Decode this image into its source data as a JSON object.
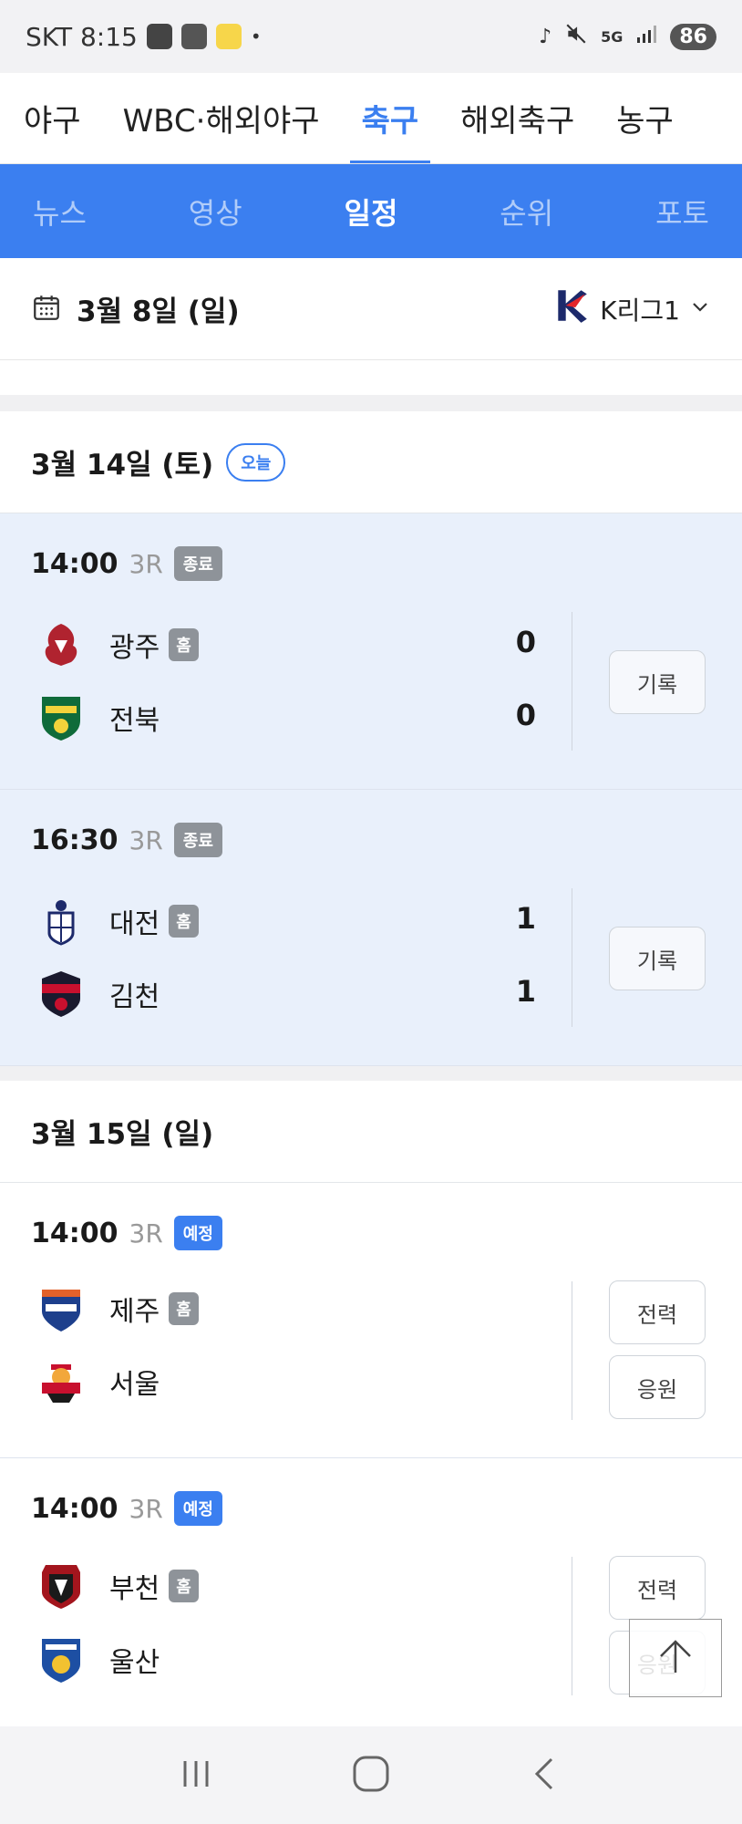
{
  "status_bar": {
    "carrier_time": "SKT 8:15",
    "network": "5G",
    "battery": "86",
    "dot": "•"
  },
  "sport_tabs": [
    "야구",
    "WBC·해외야구",
    "축구",
    "해외축구",
    "농구"
  ],
  "sub_tabs": [
    "뉴스",
    "영상",
    "일정",
    "순위",
    "포토"
  ],
  "datebar": {
    "date": "3월 8일 (일)",
    "league": "K리그1"
  },
  "sections": [
    {
      "title": "3월 14일 (토)",
      "badge": "오늘",
      "matches": [
        {
          "time": "14:00",
          "round": "3R",
          "status": "종료",
          "home": {
            "name": "광주",
            "home_badge": "홈",
            "score": "0"
          },
          "away": {
            "name": "전북",
            "score": "0"
          },
          "buttons": [
            "기록"
          ]
        },
        {
          "time": "16:30",
          "round": "3R",
          "status": "종료",
          "home": {
            "name": "대전",
            "home_badge": "홈",
            "score": "1"
          },
          "away": {
            "name": "김천",
            "score": "1"
          },
          "buttons": [
            "기록"
          ]
        }
      ]
    },
    {
      "title": "3월 15일 (일)",
      "matches": [
        {
          "time": "14:00",
          "round": "3R",
          "status": "예정",
          "home": {
            "name": "제주",
            "home_badge": "홈"
          },
          "away": {
            "name": "서울"
          },
          "buttons": [
            "전력",
            "응원"
          ]
        },
        {
          "time": "14:00",
          "round": "3R",
          "status": "예정",
          "home": {
            "name": "부천",
            "home_badge": "홈"
          },
          "away": {
            "name": "울산"
          },
          "buttons": [
            "전력",
            "응원"
          ]
        }
      ]
    }
  ],
  "colors": {
    "accent": "#3b7ff0",
    "finished_bg": "#e9f0fb",
    "badge_gray": "#8e9399"
  }
}
